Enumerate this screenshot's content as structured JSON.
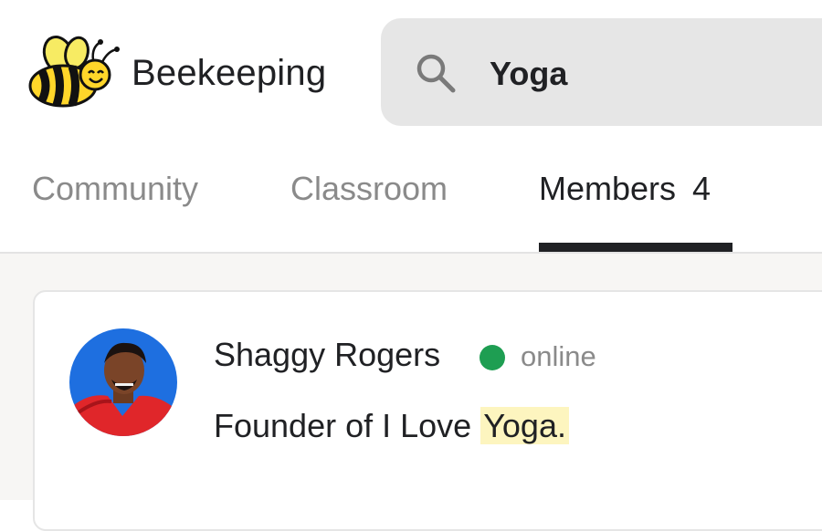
{
  "header": {
    "brand": "Beekeeping",
    "logo_icon": "bee-logo-icon",
    "search": {
      "icon": "search-icon",
      "value": "Yoga"
    }
  },
  "tabs": [
    {
      "label": "Community",
      "active": false
    },
    {
      "label": "Classroom",
      "active": false
    },
    {
      "label": "Members",
      "count": "4",
      "active": true
    }
  ],
  "member": {
    "name": "Shaggy Rogers",
    "status": "online",
    "status_color": "#1e9e52",
    "bio_prefix": "Founder of I Love ",
    "bio_highlight": "Yoga.",
    "avatar_icon": "avatar-photo"
  },
  "colors": {
    "highlight": "#fdf5bf",
    "active_tab": "#202124",
    "inactive_tab": "#8a8a8a",
    "search_bg": "#e6e6e6"
  }
}
